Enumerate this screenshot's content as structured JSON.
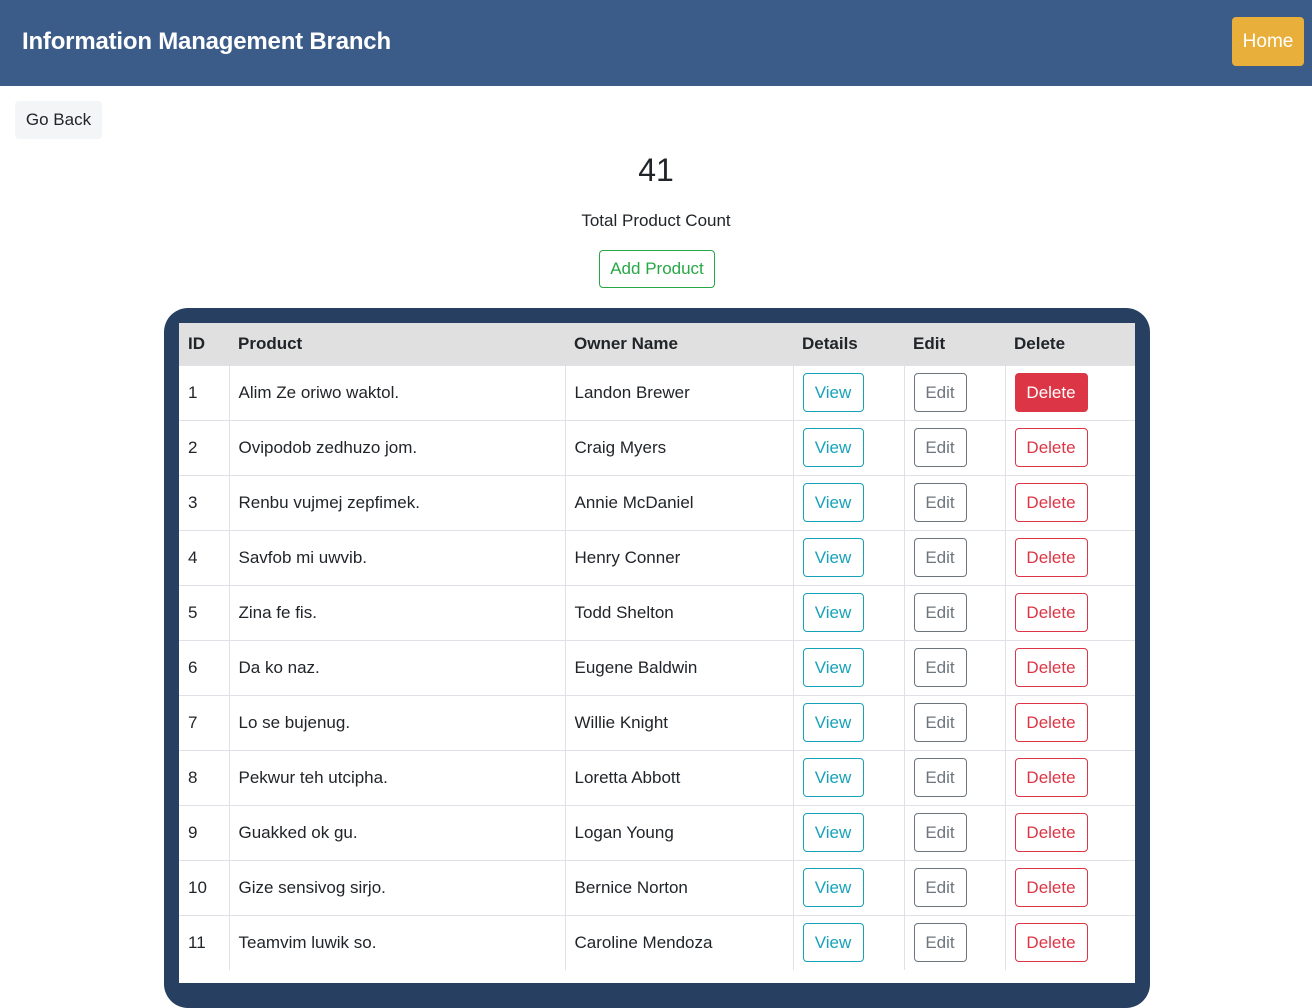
{
  "header": {
    "brand": "Information Management Branch",
    "home_label": "Home"
  },
  "toolbar": {
    "go_back_label": "Go Back"
  },
  "summary": {
    "count": "41",
    "count_label": "Total Product Count",
    "add_label": "Add Product"
  },
  "table": {
    "columns": [
      "ID",
      "Product",
      "Owner Name",
      "Details",
      "Edit",
      "Delete"
    ],
    "rows": [
      {
        "id": "1",
        "product": "Alim Ze oriwo waktol.",
        "owner": "Landon Brewer"
      },
      {
        "id": "2",
        "product": "Ovipodob zedhuzo jom.",
        "owner": "Craig Myers"
      },
      {
        "id": "3",
        "product": "Renbu vujmej zepfimek.",
        "owner": "Annie McDaniel"
      },
      {
        "id": "4",
        "product": "Savfob mi uwvib.",
        "owner": "Henry Conner"
      },
      {
        "id": "5",
        "product": "Zina fe fis.",
        "owner": "Todd Shelton"
      },
      {
        "id": "6",
        "product": "Da ko naz.",
        "owner": "Eugene Baldwin"
      },
      {
        "id": "7",
        "product": "Lo se bujenug.",
        "owner": "Willie Knight"
      },
      {
        "id": "8",
        "product": "Pekwur teh utcipha.",
        "owner": "Loretta Abbott"
      },
      {
        "id": "9",
        "product": "Guakked ok gu.",
        "owner": "Logan Young"
      },
      {
        "id": "10",
        "product": "Gize sensivog sirjo.",
        "owner": "Bernice Norton"
      },
      {
        "id": "11",
        "product": "Teamvim luwik so.",
        "owner": "Caroline Mendoza"
      }
    ],
    "view_label": "View",
    "edit_label": "Edit",
    "delete_label": "Delete",
    "highlighted_delete_row": "1"
  },
  "colors": {
    "navbar": "#3b5b89",
    "home_button": "#e8b03a",
    "table_frame": "#273f61",
    "view": "#17a2b8",
    "edit": "#6c757d",
    "delete": "#dc3545",
    "add": "#28a745"
  }
}
